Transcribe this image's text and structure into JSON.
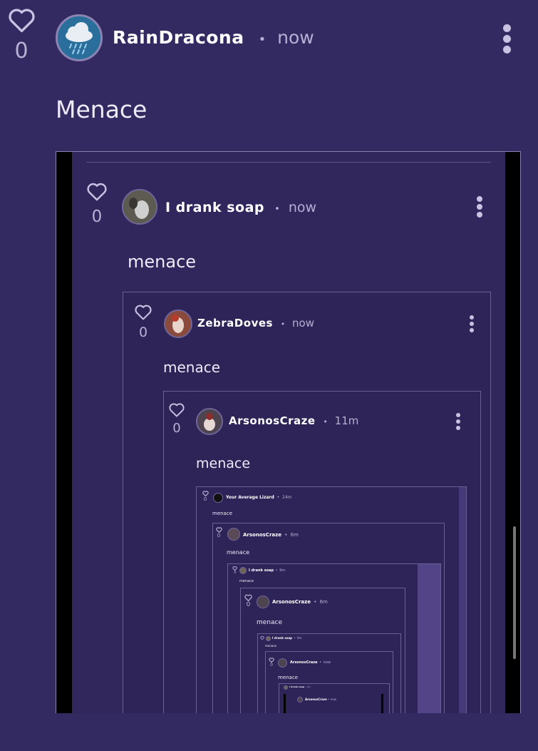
{
  "post": {
    "likes": "0",
    "username": "RainDracona",
    "separator": "•",
    "time": "now",
    "text": "Menace",
    "avatar_icon": "rain-cloud-icon"
  },
  "screenshot": {
    "level1": {
      "likes": "0",
      "username": "I drank soap",
      "separator": "•",
      "time": "now",
      "text": "menace"
    },
    "level2": {
      "likes": "0",
      "username": "ZebraDoves",
      "separator": "•",
      "time": "now",
      "text": "menace"
    },
    "level3": {
      "likes": "0",
      "username": "ArsonosCraze",
      "separator": "•",
      "time": "11m",
      "text": "menace"
    },
    "level4": {
      "likes": "0",
      "username": "Your Average Lizard",
      "separator": "•",
      "time": "24m",
      "text": "menace"
    },
    "level5": {
      "likes": "0",
      "username": "ArsonosCraze",
      "separator": "•",
      "time": "6m",
      "text": "menace"
    },
    "level6": {
      "likes": "0",
      "username": "I drank soap",
      "separator": "•",
      "time": "9m",
      "text": "menace"
    },
    "level7": {
      "likes": "0",
      "username": "ArsonosCraze",
      "separator": "•",
      "time": "6m",
      "text": "menace"
    },
    "level8": {
      "likes": "0",
      "username": "I drank soap",
      "separator": "•",
      "time": "9m",
      "text": "menace"
    },
    "level9": {
      "likes": "0",
      "username": "ArsonosCraze",
      "separator": "•",
      "time": "now",
      "text": "menace"
    },
    "level10": {
      "username": "I drank soap",
      "separator": "•",
      "time": "9m"
    },
    "level11": {
      "username": "ArsonosCraze",
      "separator": "•",
      "time": "now"
    }
  }
}
